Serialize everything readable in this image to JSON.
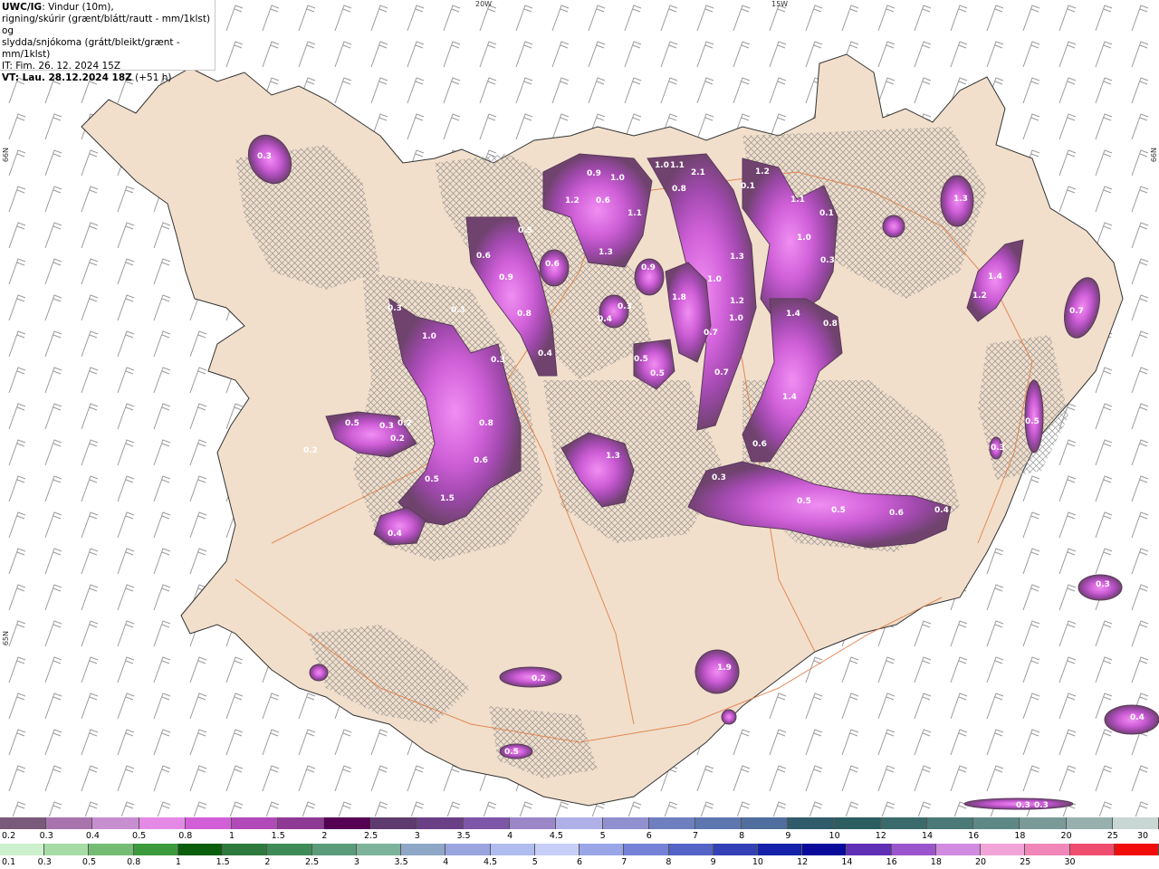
{
  "header": {
    "model": "UWC/IG",
    "line1_rest": ": Vindur (10m),",
    "line2": "rigning/skúrir (grænt/blátt/rautt - mm/1klst) og",
    "line3": "slydda/snjókoma (grátt/bleikt/grænt - mm/1klst)",
    "line4": "IT: Fim. 26. 12. 2024 15Z",
    "line5_bold": "VT: Lau. 28.12.2024 18Z",
    "line5_rest": " (+51 h)"
  },
  "coords": {
    "lon_20w": "20W",
    "lon_15w": "15W",
    "lat_66n_left": "66N",
    "lat_66n_right": "66N",
    "lat_65n_left": "65N"
  },
  "precip_labels": [
    "0.3",
    "0.9",
    "1.0",
    "1.0",
    "1.1",
    "2.1",
    "1.2",
    "0.8",
    "0.1",
    "1.1",
    "0.1",
    "1.0",
    "0.3",
    "1.3",
    "1.2",
    "0.6",
    "1.1",
    "1.3",
    "0.6",
    "0.9",
    "0.8",
    "0.4",
    "0.9",
    "1.3",
    "0.6",
    "0.5",
    "0.3",
    "1.0",
    "1.2",
    "1.0",
    "1.8",
    "0.7",
    "0.7",
    "1.4",
    "0.8",
    "0.3",
    "0.4",
    "0.3",
    "0.5",
    "0.5",
    "1.4",
    "1.2",
    "0.7",
    "1.4",
    "0.5",
    "0.3",
    "1.0",
    "0.3",
    "0.8",
    "0.6",
    "0.5",
    "1.5",
    "0.5",
    "0.3",
    "0.2",
    "0.2",
    "0.2",
    "1.3",
    "0.6",
    "0.3",
    "0.5",
    "0.5",
    "0.6",
    "0.4",
    "0.3",
    "1.9",
    "0.2",
    "0.4",
    "0.5",
    "0.3",
    "0.3",
    "0.4"
  ],
  "legend_top": {
    "colors": [
      "#7a5a7a",
      "#a974ad",
      "#c78ed0",
      "#e48ae6",
      "#d160d8",
      "#b14ab8",
      "#8e3a94",
      "#550055",
      "#5e3a6e",
      "#6b3f86",
      "#7d56a8",
      "#9b86c8",
      "#b0b0e8",
      "#9090d0",
      "#6e7fbf",
      "#5e76b0",
      "#4f6d9d",
      "#2f5b6a",
      "#2c5d60",
      "#3a6a6b",
      "#4b7977",
      "#5e8886",
      "#7a9a98",
      "#97b0ae",
      "#c8d6d4"
    ],
    "labels": [
      "0.2",
      "0.3",
      "0.4",
      "0.5",
      "0.8",
      "1",
      "1.5",
      "2",
      "2.5",
      "3",
      "3.5",
      "4",
      "4.5",
      "5",
      "6",
      "7",
      "8",
      "9",
      "10",
      "12",
      "14",
      "16",
      "18",
      "20",
      "25",
      "30"
    ]
  },
  "legend_bottom": {
    "colors": [
      "#cdf0cd",
      "#a6dca6",
      "#74bc74",
      "#3c9a3c",
      "#0b5e0b",
      "#2e7a3e",
      "#3f8b57",
      "#5a9c7a",
      "#7db39a",
      "#8fa7c6",
      "#9aa5df",
      "#b0bcef",
      "#c7cff8",
      "#9aa6e8",
      "#7582d8",
      "#5463c6",
      "#3440b6",
      "#1421a8",
      "#0a0a9a",
      "#5f2fb5",
      "#9b55cc",
      "#d18be0",
      "#f2a4d8",
      "#f087b8",
      "#ef4d6f",
      "#f20d0d"
    ],
    "labels": [
      "0.1",
      "0.3",
      "0.5",
      "0.8",
      "1",
      "1.5",
      "2",
      "2.5",
      "3",
      "3.5",
      "4",
      "4.5",
      "5",
      "6",
      "7",
      "8",
      "9",
      "10",
      "12",
      "14",
      "16",
      "18",
      "20",
      "25",
      "30"
    ]
  }
}
